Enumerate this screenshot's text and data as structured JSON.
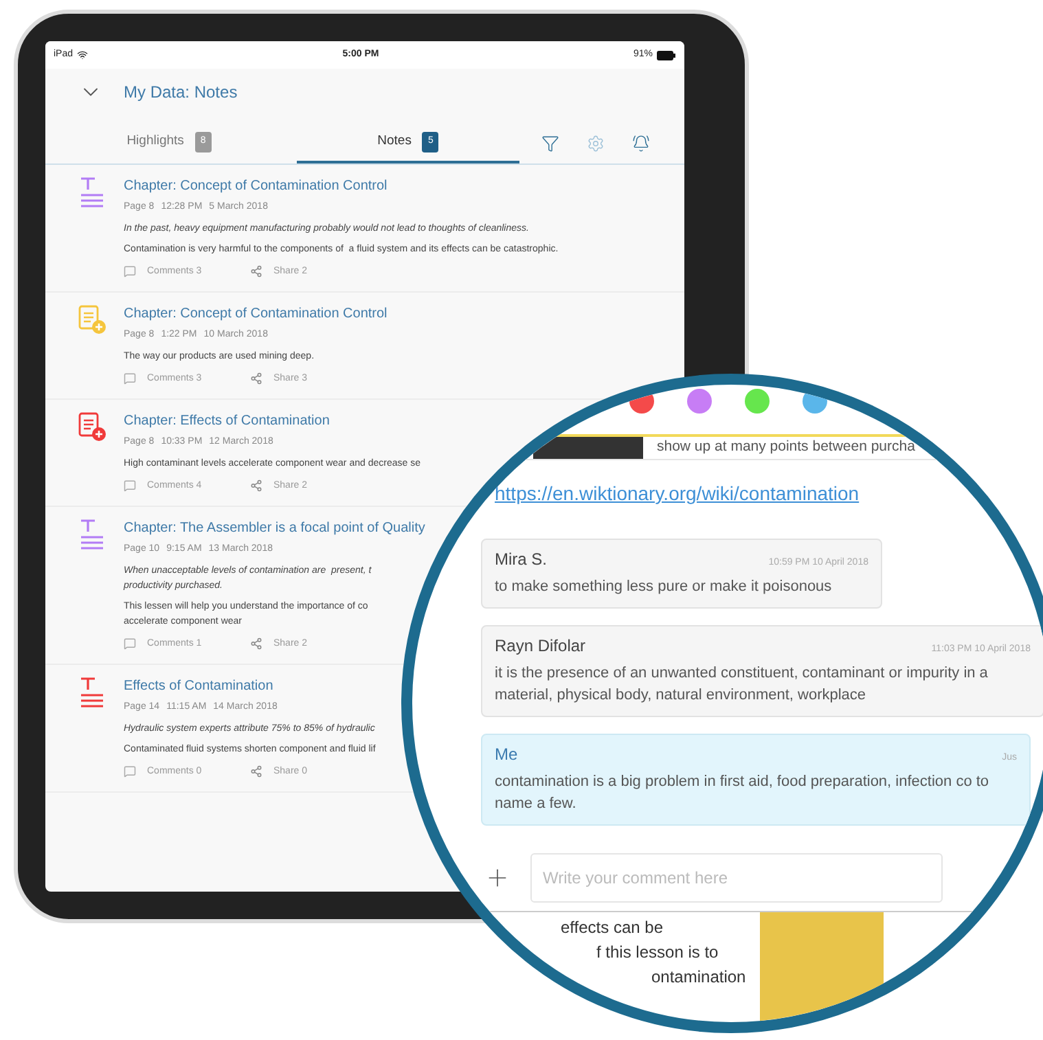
{
  "status_bar": {
    "device": "iPad",
    "time": "5:00 PM",
    "battery": "91%"
  },
  "header": {
    "title": "My Data: Notes"
  },
  "tabs": [
    {
      "label": "Highlights",
      "count": "8",
      "selected": false
    },
    {
      "label": "Notes",
      "count": "5",
      "selected": true
    }
  ],
  "notes": [
    {
      "kind": "highlight",
      "color": "#b27cf5",
      "title": "Chapter: Concept of Contamination Control",
      "page": "Page 8",
      "time": "12:28 PM",
      "date": "5 March 2018",
      "quote": "In the past, heavy equipment manufacturing probably would not lead to thoughts of cleanliness.",
      "body": "Contamination is very harmful to the components of  a fluid system and its effects can be catastrophic.",
      "comments": "Comments 3",
      "share": "Share 2"
    },
    {
      "kind": "note",
      "color": "#f5c53d",
      "title": "Chapter: Concept of Contamination Control",
      "page": "Page 8",
      "time": "1:22 PM",
      "date": "10 March 2018",
      "body": "The way our products are used mining deep.",
      "comments": "Comments 3",
      "share": "Share 3"
    },
    {
      "kind": "note",
      "color": "#f03a3a",
      "title": "Chapter: Effects of Contamination",
      "page": "Page 8",
      "time": "10:33 PM",
      "date": "12 March 2018",
      "body": "High contaminant levels accelerate component wear and decrease se",
      "comments": "Comments 4",
      "share": "Share 2"
    },
    {
      "kind": "highlight",
      "color": "#b27cf5",
      "title": "Chapter: The Assembler is a focal point of Quality",
      "page": "Page 10",
      "time": "9:15 AM",
      "date": "13 March 2018",
      "quote": "When unacceptable levels of contamination are  present, t\nproductivity purchased.",
      "body": "This lessen will help you understand the importance of co\naccelerate component wear",
      "comments": "Comments 1",
      "share": "Share 2"
    },
    {
      "kind": "highlight",
      "color": "#f03a3a",
      "title": "Effects of Contamination",
      "page": "Page 14",
      "time": "11:15 AM",
      "date": "14 March 2018",
      "quote": "Hydraulic system experts attribute 75% to 85% of hydraulic",
      "body": "Contaminated fluid systems shorten component and fluid lif",
      "comments": "Comments 0",
      "share": "Share 0"
    }
  ],
  "magnifier": {
    "colors": [
      {
        "color": "#f44a4a"
      },
      {
        "color": "#c77df5"
      },
      {
        "color": "#66e64d"
      },
      {
        "color": "#5ab6ea"
      }
    ],
    "excerpt": "show up at many points between purcha",
    "link": "https://en.wiktionary.org/wiki/contamination",
    "comments": [
      {
        "author": "Mira S.",
        "time": "10:59 PM  10 April 2018",
        "text": "to make something less pure or make it poisonous",
        "mine": false
      },
      {
        "author": "Rayn Difolar",
        "time": "11:03 PM  10 April 2018",
        "text": "it is the presence of an unwanted constituent, contaminant or impurity in a material, physical body, natural environment, workplace",
        "mine": false
      },
      {
        "author": "Me",
        "time": "Jus",
        "text": "contamination is a big problem in first aid, food preparation, infection co to name a few.",
        "mine": true
      }
    ],
    "input": {
      "placeholder": "Write your comment here"
    },
    "page_text": [
      "effects can be",
      "f this lesson is to",
      "ontamination"
    ]
  }
}
